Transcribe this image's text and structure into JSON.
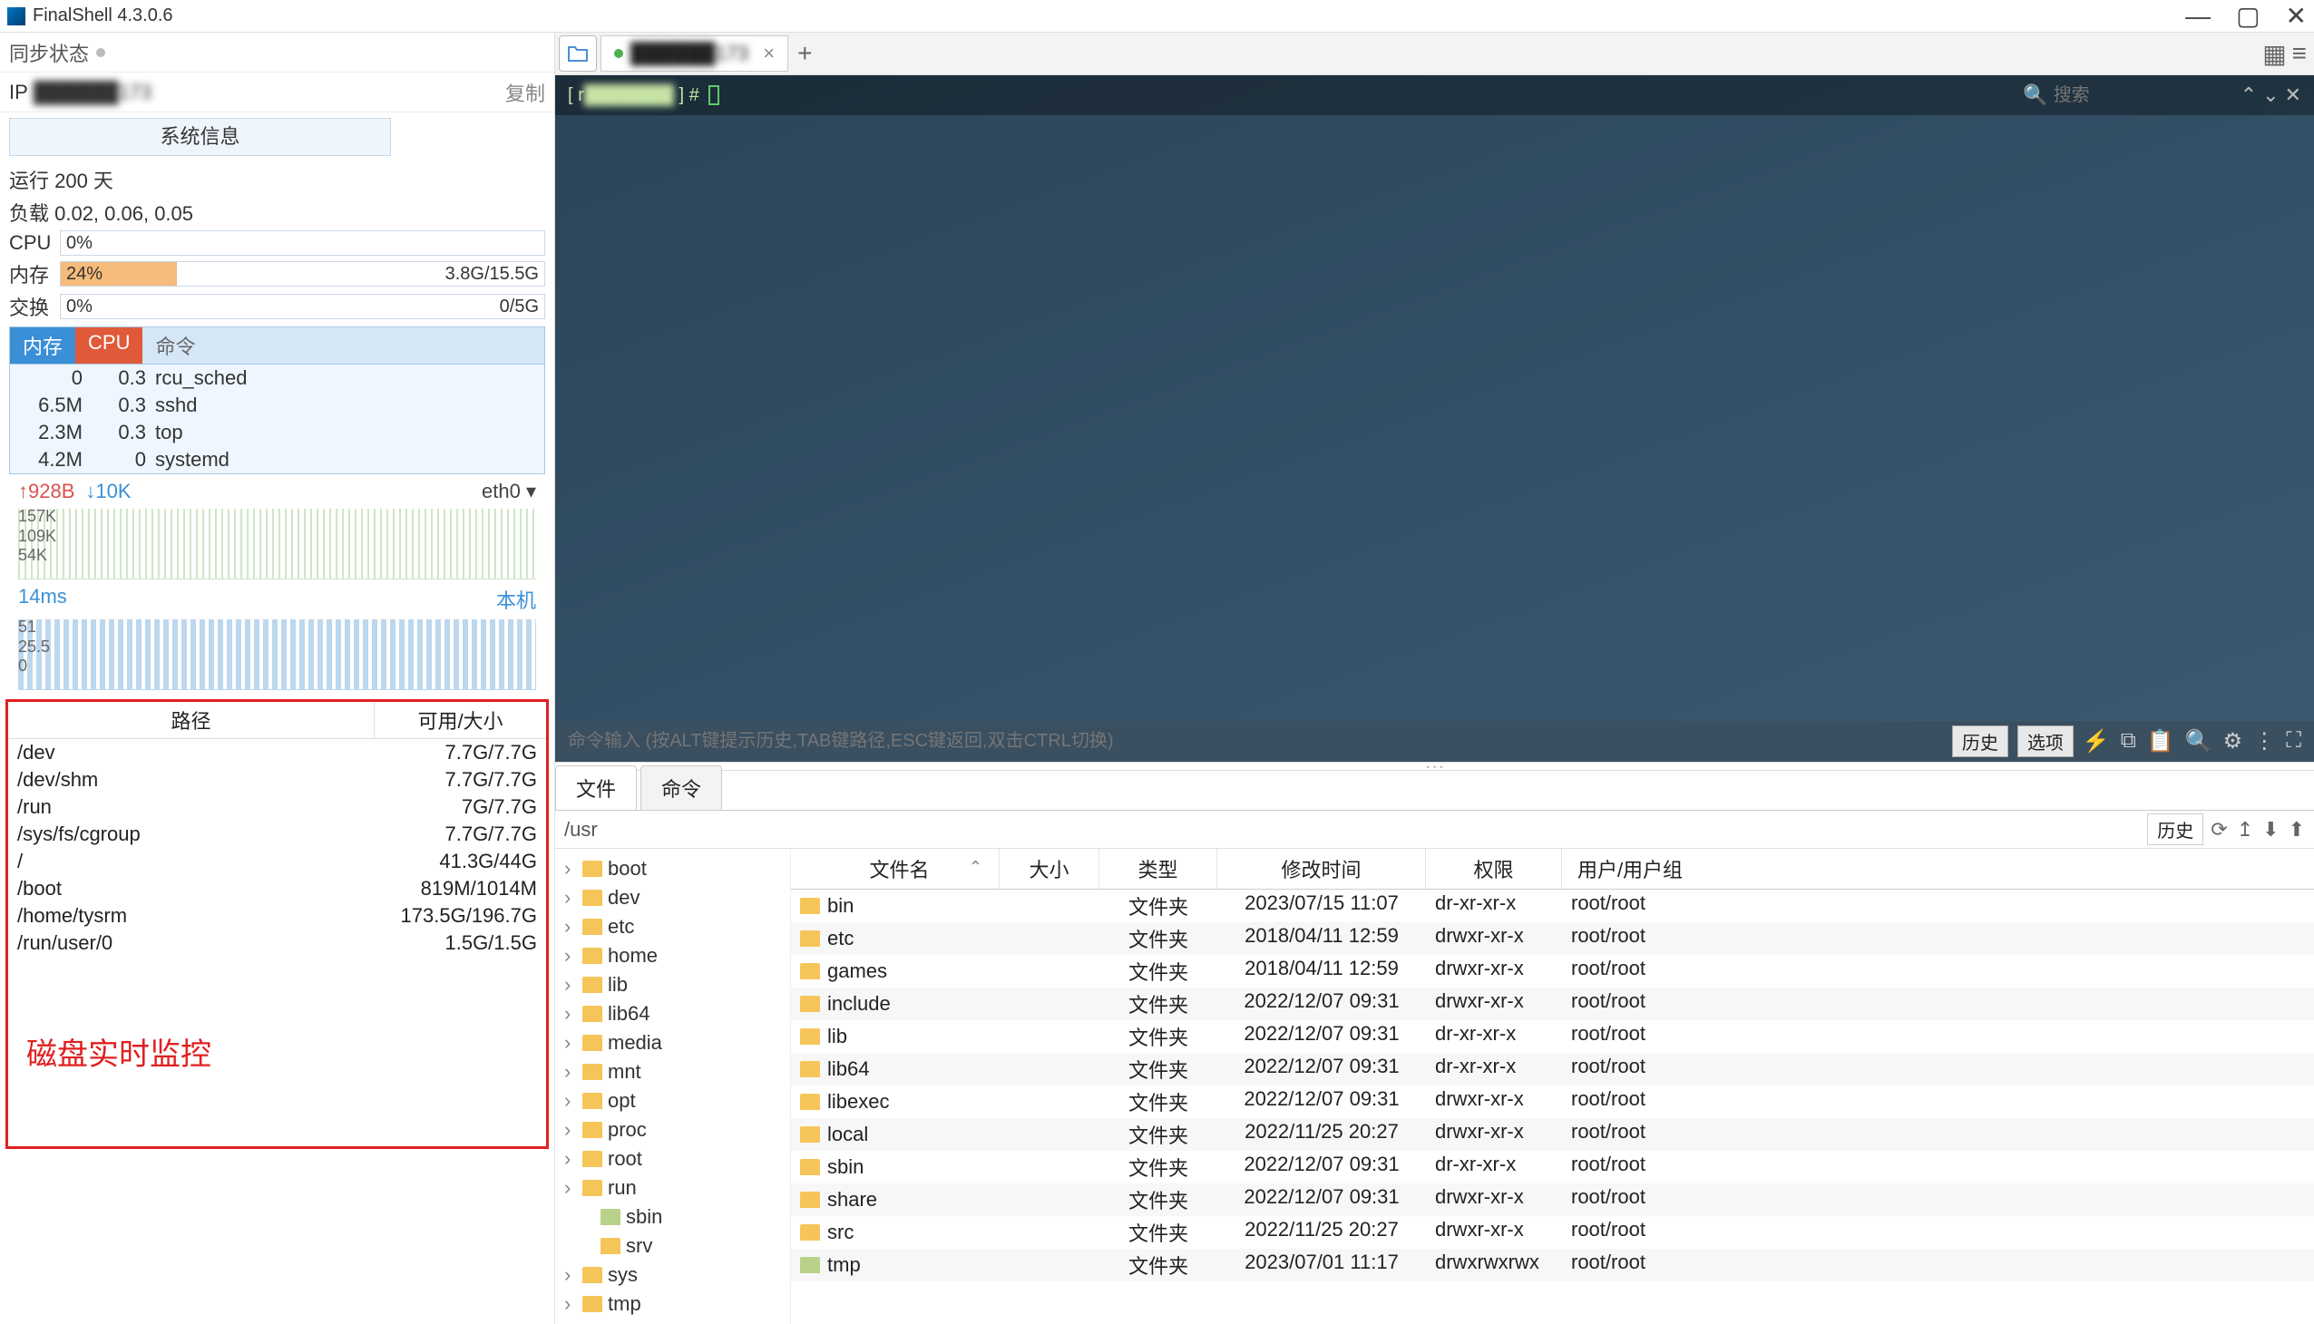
{
  "app": {
    "title": "FinalShell 4.3.0.6"
  },
  "window_controls": {
    "min": "—",
    "max": "▢",
    "close": "✕"
  },
  "sidebar": {
    "sync_label": "同步状态",
    "ip_label": "IP",
    "ip_masked": "██████173",
    "copy_label": "复制",
    "sysinfo_btn": "系统信息",
    "uptime": "运行 200 天",
    "load": "负载 0.02, 0.06, 0.05",
    "cpu_label": "CPU",
    "cpu_pct": "0%",
    "mem_label": "内存",
    "mem_pct": "24%",
    "mem_val": "3.8G/15.5G",
    "mem_fill": 24,
    "swap_label": "交换",
    "swap_pct": "0%",
    "swap_val": "0/5G",
    "proc_tabs": {
      "mem": "内存",
      "cpu": "CPU",
      "cmd": "命令"
    },
    "procs": [
      {
        "mem": "0",
        "cpu": "0.3",
        "cmd": "rcu_sched"
      },
      {
        "mem": "6.5M",
        "cpu": "0.3",
        "cmd": "sshd"
      },
      {
        "mem": "2.3M",
        "cpu": "0.3",
        "cmd": "top"
      },
      {
        "mem": "4.2M",
        "cpu": "0",
        "cmd": "systemd"
      }
    ],
    "net": {
      "up": "↑928B",
      "down": "↓10K",
      "iface": "eth0",
      "ticks": "157K\n109K\n54K"
    },
    "ping": {
      "ms": "14ms",
      "local": "本机",
      "ticks": "51\n25.5\n0"
    },
    "disk_header": {
      "path": "路径",
      "size": "可用/大小"
    },
    "disks": [
      {
        "path": "/dev",
        "size": "7.7G/7.7G"
      },
      {
        "path": "/dev/shm",
        "size": "7.7G/7.7G"
      },
      {
        "path": "/run",
        "size": "7G/7.7G"
      },
      {
        "path": "/sys/fs/cgroup",
        "size": "7.7G/7.7G"
      },
      {
        "path": "/",
        "size": "41.3G/44G"
      },
      {
        "path": "/boot",
        "size": "819M/1014M"
      },
      {
        "path": "/home/tysrm",
        "size": "173.5G/196.7G"
      },
      {
        "path": "/run/user/0",
        "size": "1.5G/1.5G"
      }
    ],
    "disk_annotation": "磁盘实时监控"
  },
  "tabbar": {
    "tab_text": "██████173",
    "plus": "+"
  },
  "terminal": {
    "prompt_left": "[ r",
    "prompt_masked": "███████",
    "prompt_right": " ] #",
    "search_placeholder": "搜索"
  },
  "cmdbar": {
    "placeholder": "命令输入 (按ALT键提示历史,TAB键路径,ESC键返回,双击CTRL切换)",
    "history": "历史",
    "options": "选项"
  },
  "filetabs": {
    "files": "文件",
    "cmds": "命令"
  },
  "pathbar": {
    "path": "/usr",
    "history": "历史"
  },
  "tree": [
    {
      "name": "boot",
      "lvl": 1
    },
    {
      "name": "dev",
      "lvl": 1
    },
    {
      "name": "etc",
      "lvl": 1
    },
    {
      "name": "home",
      "lvl": 1
    },
    {
      "name": "lib",
      "lvl": 1
    },
    {
      "name": "lib64",
      "lvl": 1
    },
    {
      "name": "media",
      "lvl": 1
    },
    {
      "name": "mnt",
      "lvl": 1
    },
    {
      "name": "opt",
      "lvl": 1
    },
    {
      "name": "proc",
      "lvl": 1
    },
    {
      "name": "root",
      "lvl": 1
    },
    {
      "name": "run",
      "lvl": 1
    },
    {
      "name": "sbin",
      "lvl": 2,
      "alt": true
    },
    {
      "name": "srv",
      "lvl": 2
    },
    {
      "name": "sys",
      "lvl": 1
    },
    {
      "name": "tmp",
      "lvl": 1
    }
  ],
  "filelist": {
    "headers": {
      "name": "文件名",
      "size": "大小",
      "type": "类型",
      "date": "修改时间",
      "perm": "权限",
      "user": "用户/用户组"
    },
    "rows": [
      {
        "name": "bin",
        "type": "文件夹",
        "date": "2023/07/15 11:07",
        "perm": "dr-xr-xr-x",
        "user": "root/root"
      },
      {
        "name": "etc",
        "type": "文件夹",
        "date": "2018/04/11 12:59",
        "perm": "drwxr-xr-x",
        "user": "root/root"
      },
      {
        "name": "games",
        "type": "文件夹",
        "date": "2018/04/11 12:59",
        "perm": "drwxr-xr-x",
        "user": "root/root"
      },
      {
        "name": "include",
        "type": "文件夹",
        "date": "2022/12/07 09:31",
        "perm": "drwxr-xr-x",
        "user": "root/root"
      },
      {
        "name": "lib",
        "type": "文件夹",
        "date": "2022/12/07 09:31",
        "perm": "dr-xr-xr-x",
        "user": "root/root"
      },
      {
        "name": "lib64",
        "type": "文件夹",
        "date": "2022/12/07 09:31",
        "perm": "dr-xr-xr-x",
        "user": "root/root"
      },
      {
        "name": "libexec",
        "type": "文件夹",
        "date": "2022/12/07 09:31",
        "perm": "drwxr-xr-x",
        "user": "root/root"
      },
      {
        "name": "local",
        "type": "文件夹",
        "date": "2022/11/25 20:27",
        "perm": "drwxr-xr-x",
        "user": "root/root"
      },
      {
        "name": "sbin",
        "type": "文件夹",
        "date": "2022/12/07 09:31",
        "perm": "dr-xr-xr-x",
        "user": "root/root"
      },
      {
        "name": "share",
        "type": "文件夹",
        "date": "2022/12/07 09:31",
        "perm": "drwxr-xr-x",
        "user": "root/root"
      },
      {
        "name": "src",
        "type": "文件夹",
        "date": "2022/11/25 20:27",
        "perm": "drwxr-xr-x",
        "user": "root/root"
      },
      {
        "name": "tmp",
        "type": "文件夹",
        "date": "2023/07/01 11:17",
        "perm": "drwxrwxrwx",
        "user": "root/root",
        "alt": true
      }
    ]
  }
}
